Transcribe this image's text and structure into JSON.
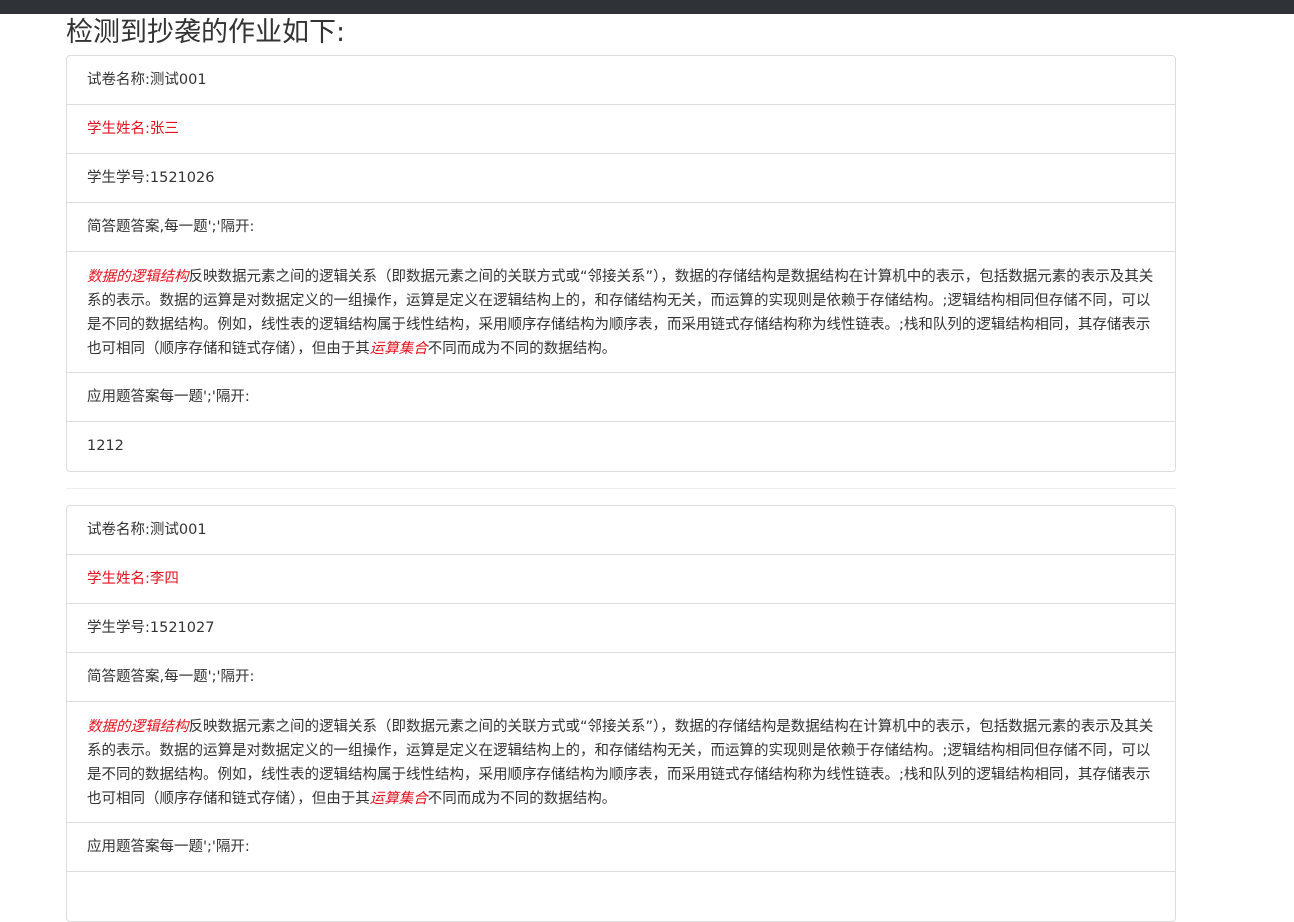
{
  "page": {
    "title": "检测到抄袭的作业如下:"
  },
  "records": [
    {
      "exam_name": "试卷名称:测试001",
      "student_name": "学生姓名:张三",
      "student_id": "学生学号:1521026",
      "short_answer_label": "简答题答案,每一题';'隔开:",
      "short_answer": {
        "highlight_start": "数据的逻辑结构",
        "body": "反映数据元素之间的逻辑关系（即数据元素之间的关联方式或“邻接关系”），数据的存储结构是数据结构在计算机中的表示，包括数据元素的表示及其关系的表示。数据的运算是对数据定义的一组操作，运算是定义在逻辑结构上的，和存储结构无关，而运算的实现则是依赖于存储结构。;逻辑结构相同但存储不同，可以是不同的数据结构。例如，线性表的逻辑结构属于线性结构，采用顺序存储结构为顺序表，而采用链式存储结构称为线性链表。;栈和队列的逻辑结构相同，其存储表示也可相同（顺序存储和链式存储），但由于其",
        "highlight_end": "运算集合",
        "tail": "不同而成为不同的数据结构。"
      },
      "application_label": "应用题答案每一题';'隔开:",
      "application_answer": "1212"
    },
    {
      "exam_name": "试卷名称:测试001",
      "student_name": "学生姓名:李四",
      "student_id": "学生学号:1521027",
      "short_answer_label": "简答题答案,每一题';'隔开:",
      "short_answer": {
        "highlight_start": "数据的逻辑结构",
        "body": "反映数据元素之间的逻辑关系（即数据元素之间的关联方式或“邻接关系”），数据的存储结构是数据结构在计算机中的表示，包括数据元素的表示及其关系的表示。数据的运算是对数据定义的一组操作，运算是定义在逻辑结构上的，和存储结构无关，而运算的实现则是依赖于存储结构。;逻辑结构相同但存储不同，可以是不同的数据结构。例如，线性表的逻辑结构属于线性结构，采用顺序存储结构为顺序表，而采用链式存储结构称为线性链表。;栈和队列的逻辑结构相同，其存储表示也可相同（顺序存储和链式存储），但由于其",
        "highlight_end": "运算集合",
        "tail": "不同而成为不同的数据结构。"
      },
      "application_label": "应用题答案每一题';'隔开:"
    }
  ],
  "colors": {
    "topbar": "#2f3237",
    "highlight_red": "#e0131f",
    "border": "#dddddd"
  }
}
